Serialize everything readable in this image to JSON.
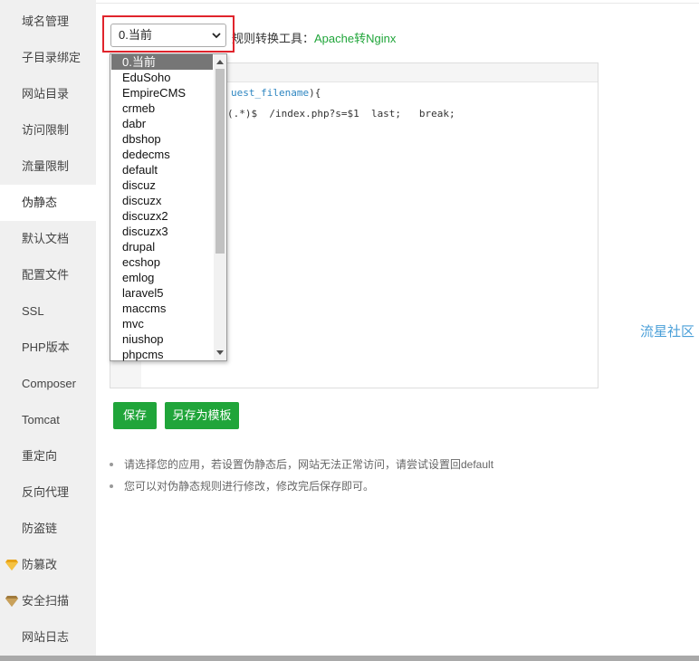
{
  "sidebar": {
    "items": [
      {
        "label": "域名管理"
      },
      {
        "label": "子目录绑定"
      },
      {
        "label": "网站目录"
      },
      {
        "label": "访问限制"
      },
      {
        "label": "流量限制"
      },
      {
        "label": "伪静态",
        "active": true
      },
      {
        "label": "默认文档"
      },
      {
        "label": "配置文件"
      },
      {
        "label": "SSL"
      },
      {
        "label": "PHP版本"
      },
      {
        "label": "Composer"
      },
      {
        "label": "Tomcat"
      },
      {
        "label": "重定向"
      },
      {
        "label": "反向代理"
      },
      {
        "label": "防盗链"
      },
      {
        "label": "防篡改",
        "icon": "gem-icon"
      },
      {
        "label": "安全扫描",
        "icon": "gem-icon"
      },
      {
        "label": "网站日志"
      }
    ]
  },
  "template_select": {
    "value": "0.当前",
    "options": [
      "0.当前",
      "EduSoho",
      "EmpireCMS",
      "crmeb",
      "dabr",
      "dbshop",
      "dedecms",
      "default",
      "discuz",
      "discuzx",
      "discuzx2",
      "discuzx3",
      "drupal",
      "ecshop",
      "emlog",
      "laravel5",
      "maccms",
      "mvc",
      "niushop",
      "phpcms"
    ]
  },
  "tool": {
    "label": "规则转换工具：",
    "link": "Apache转Nginx"
  },
  "editor": {
    "line1_kw": "uest_filename",
    "line1_rest": "){",
    "line2": "(.*)$  /index.php?s=$1  last;   break;"
  },
  "buttons": {
    "save": "保存",
    "save_as_template": "另存为模板"
  },
  "watermark": "流星社区",
  "tips": [
    "请选择您的应用，若设置伪静态后，网站无法正常访问，请尝试设置回default",
    "您可以对伪静态规则进行修改，修改完后保存即可。"
  ],
  "colors": {
    "accent": "#20a53a",
    "highlight": "#e0242c",
    "gem": "#e8a317"
  }
}
